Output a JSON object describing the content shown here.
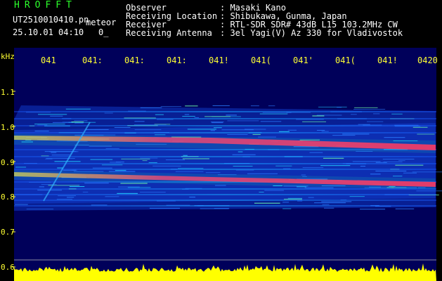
{
  "header": {
    "brand": "HROFFT",
    "filename": "UT2510010410.pn",
    "mode": "meteor",
    "timestamp": "25.10.01 04:10",
    "index": "0_",
    "info_labels": [
      "Observer",
      "Receiving Location",
      "Receiver",
      "Receiving Antenna"
    ],
    "info_values": [
      ": Masaki Kano",
      ": Shibukawa, Gunma, Japan",
      ": RTL-SDR SDR# 43dB L15 103.2MHz CW",
      ": 3el Yagi(V) Az 330 for Vladivostok"
    ]
  },
  "axes": {
    "unit": "kHz",
    "time_ticks": [
      "041",
      "041:",
      "041:",
      "041:",
      "041!",
      "041(",
      "041'",
      "041(",
      "041!",
      "0420"
    ],
    "freq_ticks": [
      "1.1",
      "1.0",
      "0.9",
      "0.8",
      "0.7",
      "0.6"
    ]
  },
  "colors": {
    "background": "#000000",
    "plot_bg": "#00005a",
    "tick_text": "#ffff33",
    "title_green": "#2cff2c",
    "signal_hot": "#ff2060",
    "noise_floor": "#ffff00"
  }
}
